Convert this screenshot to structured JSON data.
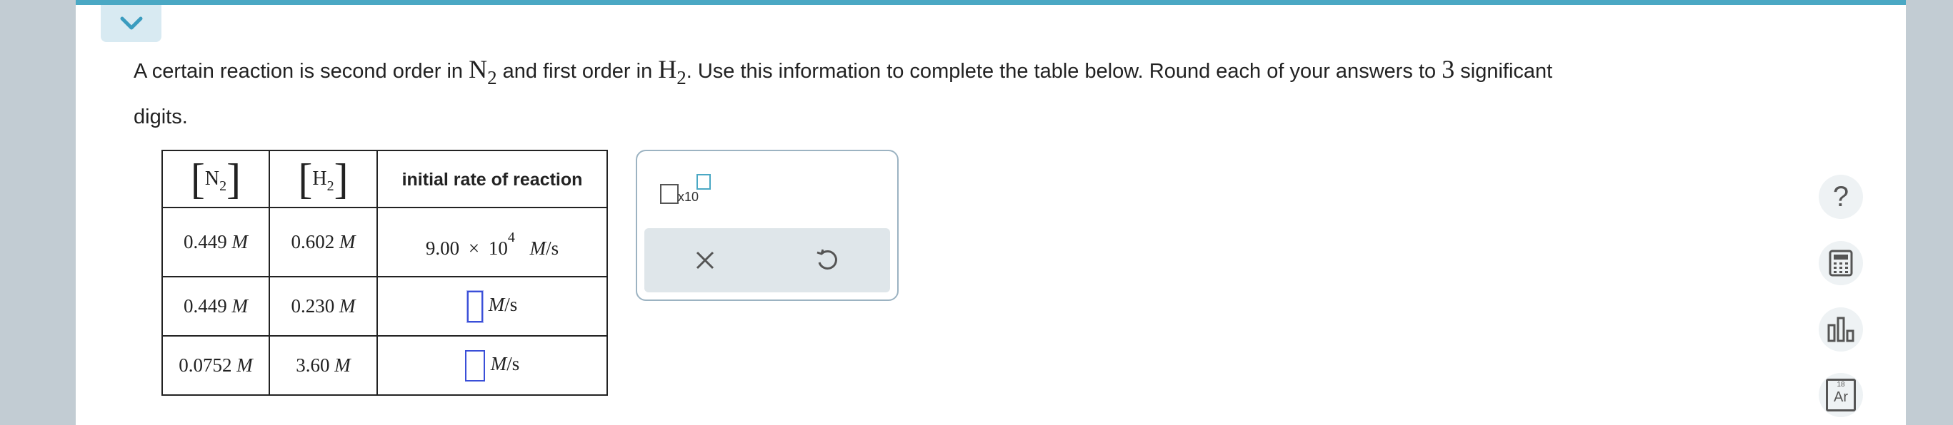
{
  "problem": {
    "part1": "A certain reaction is second order in ",
    "reactant1": "N",
    "reactant1_sub": "2",
    "part2": " and first order in ",
    "reactant2": "H",
    "reactant2_sub": "2",
    "part3": ". Use this information to complete the table below. Round each of your answers to ",
    "sigfigs": "3",
    "part4": " significant",
    "line2": "digits."
  },
  "table": {
    "col1_symbol": "N",
    "col1_sub": "2",
    "col2_symbol": "H",
    "col2_sub": "2",
    "col3_header": "initial rate of reaction",
    "unit_M": "M",
    "rate_unit_M": "M",
    "rate_unit_rest": "/s",
    "rows": [
      {
        "n2": "0.449",
        "h2": "0.602",
        "rate_mantissa": "9.00",
        "times": "×",
        "rate_base": "10",
        "rate_exp": "4"
      },
      {
        "n2": "0.449",
        "h2": "0.230"
      },
      {
        "n2": "0.0752",
        "h2": "3.60"
      }
    ]
  },
  "popup": {
    "x10_label": "x10"
  },
  "tools": [
    "help-icon",
    "calculator-icon",
    "chart-icon",
    "periodic-table-icon"
  ],
  "periodic": {
    "number": "18",
    "symbol": "Ar"
  },
  "help_glyph": "?"
}
